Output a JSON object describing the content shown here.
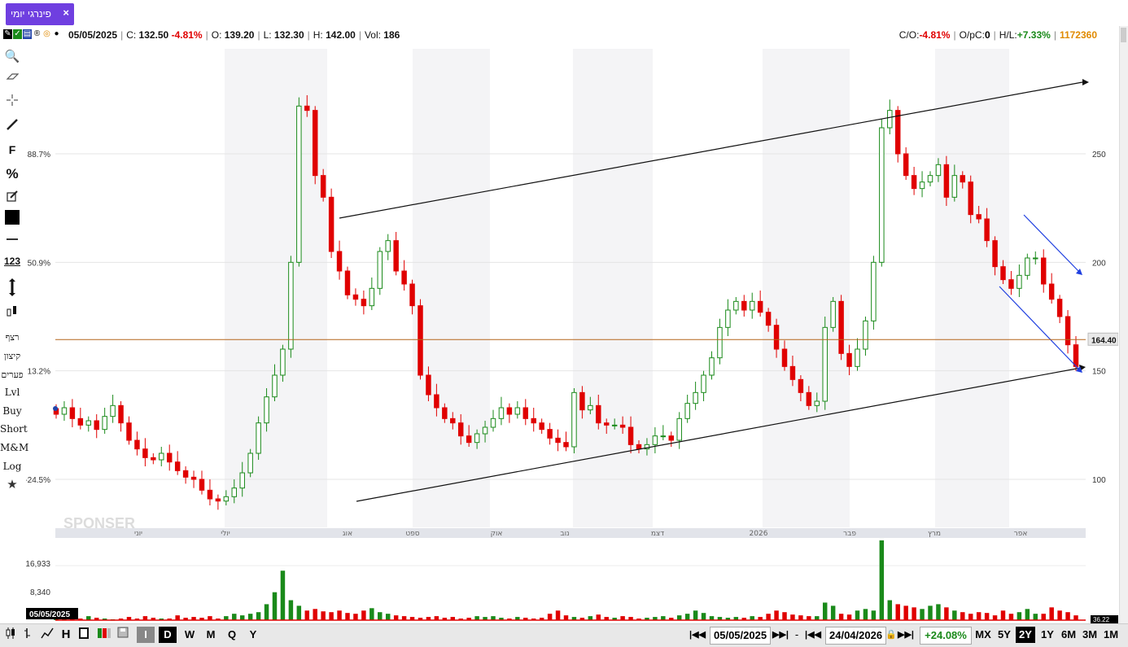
{
  "tab": {
    "title": "פינרגי יומי",
    "close": "×"
  },
  "info": {
    "date": "05/05/2025",
    "close_label": "C:",
    "close": "132.50",
    "close_change": "-4.81%",
    "open_label": "O:",
    "open": "139.20",
    "low_label": "L:",
    "low": "132.30",
    "high_label": "H:",
    "high": "142.00",
    "vol_label": "Vol:",
    "vol": "186",
    "co_label": "C/O:",
    "co": "-4.81%",
    "opc_label": "O/pC:",
    "opc": "0",
    "hl_label": "H/L:",
    "hl": "+7.33%",
    "code": "1172360"
  },
  "toolbar": {
    "buttons_text": [
      "רצף",
      "קיצון",
      "פערים",
      "Lvl",
      "Buy",
      "Short",
      "M&M",
      "Log"
    ],
    "shapes_text": [
      "F",
      "%",
      "123"
    ]
  },
  "chart": {
    "left_axis": [
      "88.7%",
      "50.9%",
      "13.2%",
      "-24.5%"
    ],
    "right_axis": [
      "250",
      "200",
      "150",
      "100"
    ],
    "months": [
      "יוני",
      "יולי",
      "אוג",
      "ספט",
      "אוק",
      "נוב",
      "דצמ",
      "2026",
      "פבר",
      "מרץ",
      "אפר"
    ],
    "price_line": "164.40",
    "vol_axis": [
      "16,933",
      "8,340"
    ],
    "date_label": "05/05/2025",
    "vol_cut": "36.22",
    "watermark": "SPONSER",
    "colors": {
      "up": "#1a8a1a",
      "down": "#e00000",
      "trend": "#111111",
      "channel": "#1f3fe0",
      "price": "#b4651a"
    }
  },
  "chart_data": {
    "type": "candlestick",
    "y_right_ticks": [
      250,
      200,
      150,
      100
    ],
    "price_now": 164.4,
    "path": [
      130,
      133,
      128,
      125,
      127,
      123,
      129,
      134,
      126,
      118,
      114,
      110,
      109,
      112,
      108,
      104,
      101,
      100,
      95,
      91,
      90,
      92,
      96,
      103,
      112,
      126,
      138,
      148,
      160,
      200,
      272,
      270,
      240,
      230,
      205,
      196,
      185,
      183,
      180,
      188,
      205,
      210,
      196,
      190,
      180,
      148,
      139,
      133,
      128,
      126,
      120,
      117,
      121,
      124,
      128,
      133,
      130,
      133,
      128,
      126,
      123,
      119,
      117,
      115,
      140,
      132,
      134,
      126,
      125,
      125,
      124,
      116,
      114,
      116,
      120,
      120,
      118,
      128,
      135,
      140,
      148,
      156,
      170,
      178,
      182,
      178,
      182,
      177,
      171,
      160,
      152,
      146,
      140,
      134,
      136,
      170,
      182,
      158,
      152,
      160,
      173,
      200,
      262,
      270,
      250,
      240,
      234,
      237,
      240,
      245,
      230,
      240,
      237,
      222,
      220,
      210,
      198,
      192,
      188,
      194,
      202,
      202,
      190,
      183,
      175,
      162,
      152
    ],
    "volume": [
      0.02,
      0.03,
      0.01,
      0.02,
      0.05,
      0.03,
      0.02,
      0.01,
      0.02,
      0.04,
      0.02,
      0.05,
      0.03,
      0.02,
      0.02,
      0.06,
      0.03,
      0.04,
      0.03,
      0.05,
      0.02,
      0.05,
      0.08,
      0.06,
      0.08,
      0.1,
      0.2,
      0.35,
      0.62,
      0.25,
      0.18,
      0.12,
      0.14,
      0.11,
      0.1,
      0.12,
      0.09,
      0.08,
      0.12,
      0.15,
      0.1,
      0.08,
      0.06,
      0.05,
      0.04,
      0.03,
      0.04,
      0.05,
      0.03,
      0.04,
      0.02,
      0.03,
      0.05,
      0.04,
      0.05,
      0.03,
      0.02,
      0.04,
      0.03,
      0.02,
      0.03,
      0.08,
      0.12,
      0.06,
      0.04,
      0.03,
      0.05,
      0.07,
      0.04,
      0.03,
      0.05,
      0.04,
      0.02,
      0.03,
      0.04,
      0.05,
      0.03,
      0.06,
      0.08,
      0.12,
      0.09,
      0.05,
      0.04,
      0.03,
      0.04,
      0.03,
      0.05,
      0.04,
      0.08,
      0.12,
      0.1,
      0.07,
      0.06,
      0.05,
      0.05,
      0.22,
      0.18,
      0.08,
      0.07,
      0.12,
      0.14,
      0.12,
      1.0,
      0.25,
      0.2,
      0.18,
      0.16,
      0.14,
      0.18,
      0.2,
      0.16,
      0.12,
      0.1,
      0.08,
      0.1,
      0.09,
      0.06,
      0.12,
      0.08,
      0.1,
      0.14,
      0.08,
      0.08,
      0.16,
      0.12,
      0.1,
      0.06
    ],
    "trendlines": [
      {
        "name": "upper",
        "from": [
          0.26,
          0.48
        ],
        "to": [
          1.0,
          0.75
        ]
      },
      {
        "name": "lower",
        "from": [
          0.27,
          0.0
        ],
        "to": [
          1.0,
          0.27
        ]
      }
    ]
  },
  "bottombar": {
    "left_buttons": [
      "I",
      "D",
      "W",
      "M",
      "Q",
      "Y"
    ],
    "date_from": "05/05/2025",
    "dash": "-",
    "date_to": "24/04/2026",
    "change": "+24.08%",
    "ranges": [
      "MX",
      "5Y",
      "2Y",
      "1Y",
      "6M",
      "3M",
      "1M"
    ],
    "selected_range": "2Y"
  }
}
